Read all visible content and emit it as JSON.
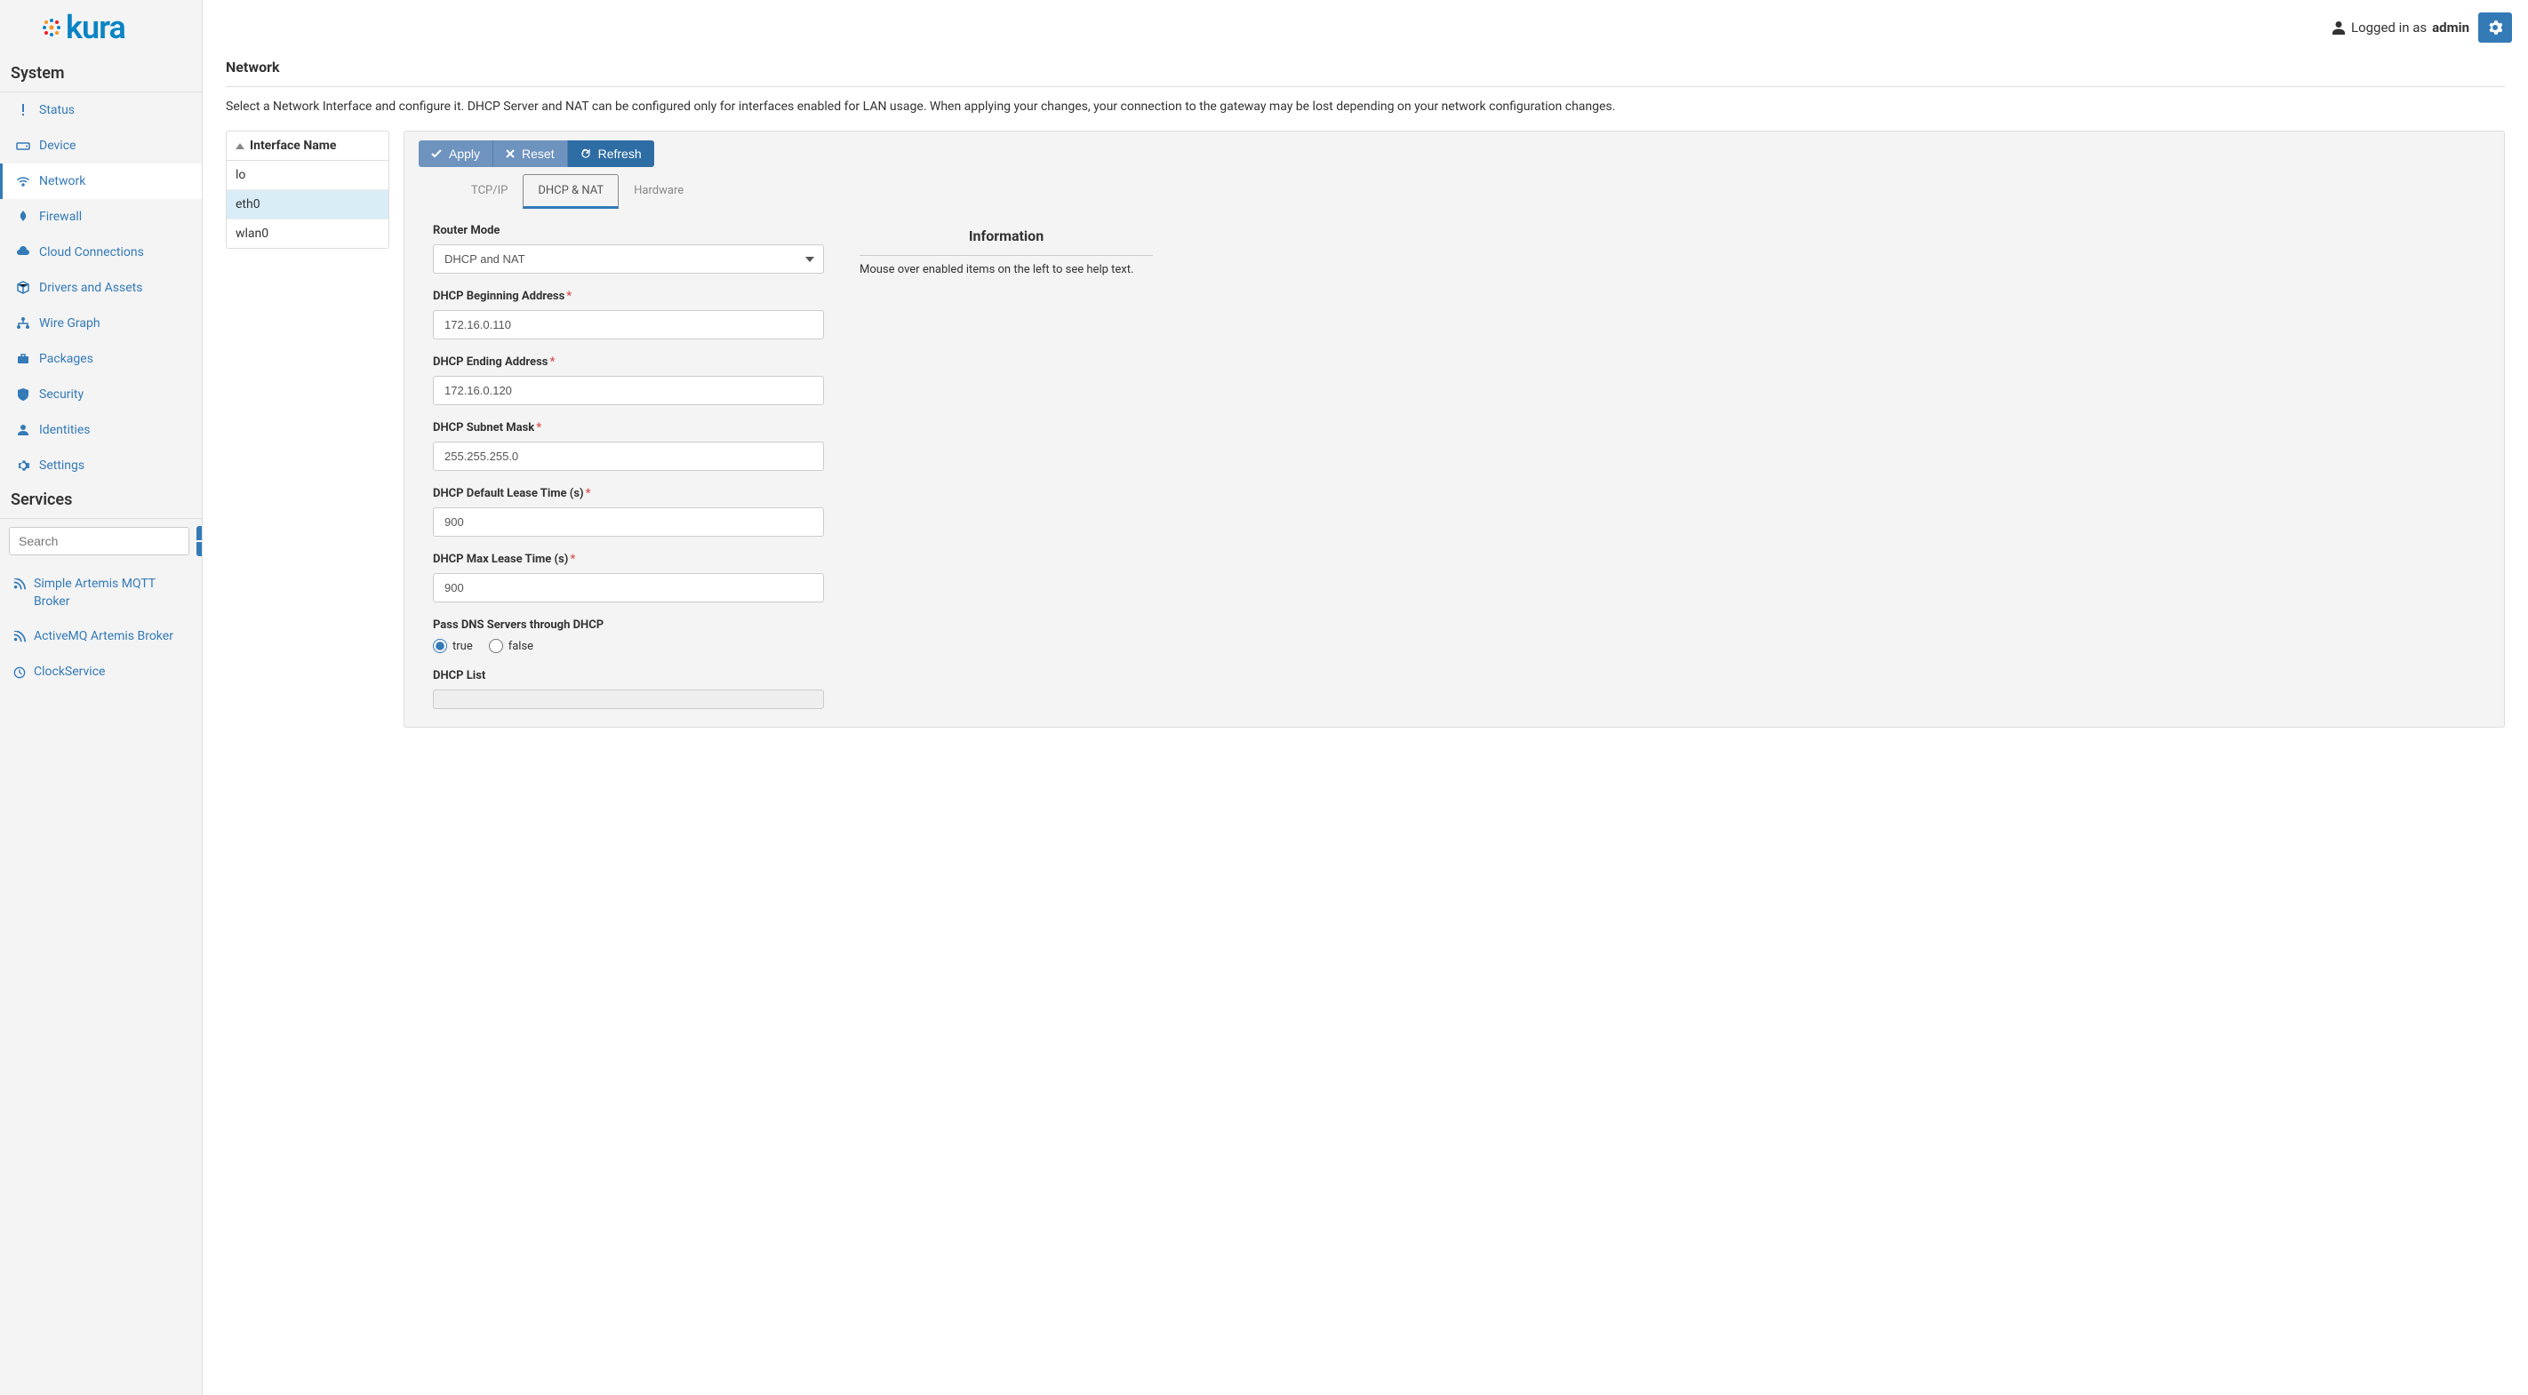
{
  "header": {
    "logged_in_label": "Logged in as",
    "username": "admin"
  },
  "sidebar": {
    "system_title": "System",
    "services_title": "Services",
    "nav": [
      {
        "label": "Status",
        "icon": "exclamation"
      },
      {
        "label": "Device",
        "icon": "hdd"
      },
      {
        "label": "Network",
        "icon": "wifi",
        "active": true
      },
      {
        "label": "Firewall",
        "icon": "fire"
      },
      {
        "label": "Cloud Connections",
        "icon": "cloud"
      },
      {
        "label": "Drivers and Assets",
        "icon": "cube"
      },
      {
        "label": "Wire Graph",
        "icon": "sitemap"
      },
      {
        "label": "Packages",
        "icon": "briefcase"
      },
      {
        "label": "Security",
        "icon": "shield"
      },
      {
        "label": "Identities",
        "icon": "user"
      },
      {
        "label": "Settings",
        "icon": "gear"
      }
    ],
    "search_placeholder": "Search",
    "services": [
      {
        "label": "Simple Artemis MQTT Broker",
        "icon": "rss"
      },
      {
        "label": "ActiveMQ Artemis Broker",
        "icon": "rss"
      },
      {
        "label": "ClockService",
        "icon": "clock"
      }
    ]
  },
  "page": {
    "title": "Network",
    "description": "Select a Network Interface and configure it. DHCP Server and NAT can be configured only for interfaces enabled for LAN usage. When applying your changes, your connection to the gateway may be lost depending on your network configuration changes."
  },
  "interfaces": {
    "header": "Interface Name",
    "items": [
      "lo",
      "eth0",
      "wlan0"
    ],
    "selected": "eth0"
  },
  "buttons": {
    "apply": "Apply",
    "reset": "Reset",
    "refresh": "Refresh"
  },
  "tabs": {
    "items": [
      "TCP/IP",
      "DHCP & NAT",
      "Hardware"
    ],
    "active": "DHCP & NAT"
  },
  "info": {
    "title": "Information",
    "text": "Mouse over enabled items on the left to see help text."
  },
  "form": {
    "router_mode": {
      "label": "Router Mode",
      "value": "DHCP and NAT"
    },
    "begin_addr": {
      "label": "DHCP Beginning Address",
      "value": "172.16.0.110",
      "required": true
    },
    "end_addr": {
      "label": "DHCP Ending Address",
      "value": "172.16.0.120",
      "required": true
    },
    "subnet": {
      "label": "DHCP Subnet Mask",
      "value": "255.255.255.0",
      "required": true
    },
    "default_lease": {
      "label": "DHCP Default Lease Time (s)",
      "value": "900",
      "required": true
    },
    "max_lease": {
      "label": "DHCP Max Lease Time (s)",
      "value": "900",
      "required": true
    },
    "pass_dns": {
      "label": "Pass DNS Servers through DHCP",
      "true_label": "true",
      "false_label": "false",
      "value": "true"
    },
    "dhcp_list": {
      "label": "DHCP List"
    }
  }
}
